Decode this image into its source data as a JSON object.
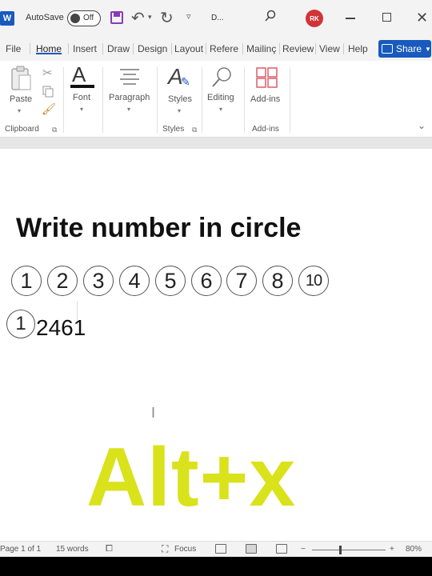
{
  "titlebar": {
    "autosave_label": "AutoSave",
    "autosave_state": "Off",
    "doc_title": "D...",
    "avatar_initials": "RK"
  },
  "tabs": [
    "File",
    "Home",
    "Insert",
    "Draw",
    "Design",
    "Layout",
    "Refere",
    "Mailinç",
    "Review",
    "View",
    "Help"
  ],
  "active_tab": "Home",
  "share_label": "Share",
  "ribbon": {
    "paste_label": "Paste",
    "font_label": "Font",
    "paragraph_label": "Paragraph",
    "styles_label": "Styles",
    "editing_label": "Editing",
    "addins_label": "Add-ins",
    "groups": {
      "clipboard": "Clipboard",
      "styles": "Styles",
      "addins": "Add-ins"
    }
  },
  "document": {
    "heading": "Write number in circle",
    "circled_numbers": [
      "1",
      "2",
      "3",
      "4",
      "5",
      "6",
      "7",
      "8",
      "10"
    ],
    "line2_circle": "1",
    "line2_text": "2461"
  },
  "overlay_text": "Alt+x",
  "status": {
    "page": "Page 1 of 1",
    "words": "15 words",
    "focus": "Focus",
    "zoom": "80%"
  },
  "colors": {
    "accent": "#185abd",
    "overlay": "#d9e21b",
    "avatar": "#d13438"
  }
}
